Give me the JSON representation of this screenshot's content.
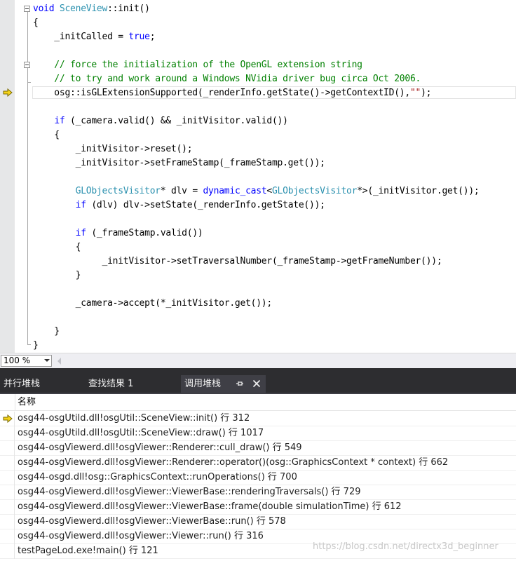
{
  "editor": {
    "lines": [
      [
        {
          "t": "void",
          "c": "kw"
        },
        {
          "t": " "
        },
        {
          "t": "SceneView",
          "c": "ty"
        },
        {
          "t": "::init()"
        }
      ],
      [
        {
          "t": "{"
        }
      ],
      [
        {
          "t": "    _initCalled = "
        },
        {
          "t": "true",
          "c": "kw"
        },
        {
          "t": ";"
        }
      ],
      [],
      [
        {
          "t": "    // force the initialization of the OpenGL extension string",
          "c": "cm"
        }
      ],
      [
        {
          "t": "    // to try and work around a Windows NVidia driver bug circa Oct 2006.",
          "c": "cm"
        }
      ],
      [
        {
          "t": "    osg::isGLExtensionSupported(_renderInfo.getState()->getContextID(),"
        },
        {
          "t": "\"\"",
          "c": "st"
        },
        {
          "t": ");"
        }
      ],
      [],
      [
        {
          "t": "    "
        },
        {
          "t": "if",
          "c": "kw"
        },
        {
          "t": " (_camera.valid() && _initVisitor.valid())"
        }
      ],
      [
        {
          "t": "    {"
        }
      ],
      [
        {
          "t": "        _initVisitor->reset();"
        }
      ],
      [
        {
          "t": "        _initVisitor->setFrameStamp(_frameStamp.get());"
        }
      ],
      [],
      [
        {
          "t": "        "
        },
        {
          "t": "GLObjectsVisitor",
          "c": "ty"
        },
        {
          "t": "* dlv = "
        },
        {
          "t": "dynamic_cast",
          "c": "kw"
        },
        {
          "t": "<"
        },
        {
          "t": "GLObjectsVisitor",
          "c": "ty"
        },
        {
          "t": "*>(_initVisitor.get());"
        }
      ],
      [
        {
          "t": "        "
        },
        {
          "t": "if",
          "c": "kw"
        },
        {
          "t": " (dlv) dlv->setState(_renderInfo.getState());"
        }
      ],
      [],
      [
        {
          "t": "        "
        },
        {
          "t": "if",
          "c": "kw"
        },
        {
          "t": " (_frameStamp.valid())"
        }
      ],
      [
        {
          "t": "        {"
        }
      ],
      [
        {
          "t": "             _initVisitor->setTraversalNumber(_frameStamp->getFrameNumber());"
        }
      ],
      [
        {
          "t": "        }"
        }
      ],
      [],
      [
        {
          "t": "        _camera->accept(*_initVisitor.get());"
        }
      ],
      [],
      [
        {
          "t": "    }"
        }
      ],
      [
        {
          "t": "}"
        }
      ]
    ]
  },
  "zoom": {
    "value": "100 %"
  },
  "tabs": [
    {
      "label": "并行堆栈"
    },
    {
      "label": "查找结果 1"
    },
    {
      "label": "调用堆栈",
      "active": true
    }
  ],
  "callstack": {
    "column_header": "名称",
    "rows": [
      "osg44-osgUtild.dll!osgUtil::SceneView::init() 行 312",
      "osg44-osgUtild.dll!osgUtil::SceneView::draw() 行 1017",
      "osg44-osgViewerd.dll!osgViewer::Renderer::cull_draw() 行 549",
      "osg44-osgViewerd.dll!osgViewer::Renderer::operator()(osg::GraphicsContext * context) 行 662",
      "osg44-osgd.dll!osg::GraphicsContext::runOperations() 行 700",
      "osg44-osgViewerd.dll!osgViewer::ViewerBase::renderingTraversals() 行 729",
      "osg44-osgViewerd.dll!osgViewer::ViewerBase::frame(double simulationTime) 行 612",
      "osg44-osgViewerd.dll!osgViewer::ViewerBase::run() 行 578",
      "osg44-osgViewerd.dll!osgViewer::Viewer::run() 行 316",
      "testPageLod.exe!main() 行 121"
    ]
  },
  "watermark": "https://blog.csdn.net/directx3d_beginner",
  "colors": {
    "keyword": "#0000ff",
    "type": "#2b91af",
    "comment": "#008000",
    "string": "#a31515",
    "tab_strip": "#2d2d30",
    "next_statement_arrow": "#f5d31a"
  },
  "icons": {
    "execution_arrow": "next-statement-arrow-icon",
    "pin": "pin-icon",
    "close": "close-icon"
  }
}
